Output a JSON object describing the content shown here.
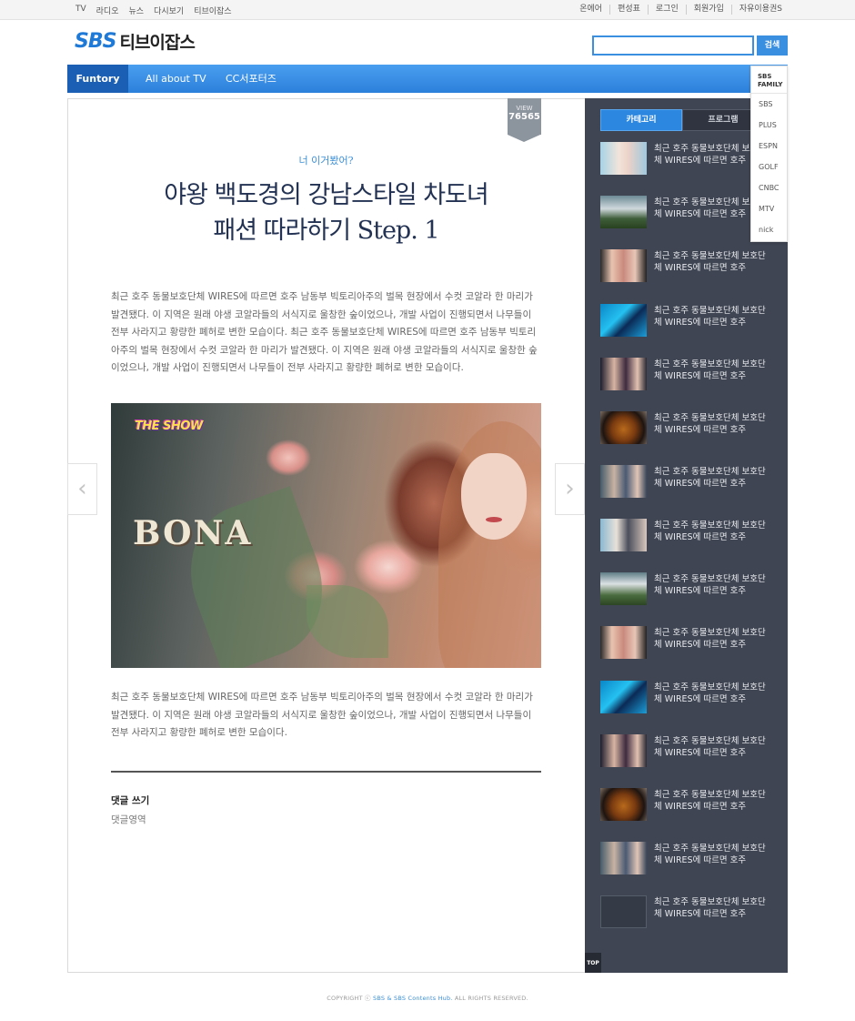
{
  "util": {
    "left_links": [
      "TV",
      "라디오",
      "뉴스",
      "다시보기",
      "티브이잡스"
    ],
    "right_links": [
      "온에어",
      "편성표",
      "로그인",
      "회원가입",
      "자유이용권S"
    ]
  },
  "header": {
    "logo_sbs": "SBS",
    "logo_name": "티브이잡스",
    "search_placeholder": "",
    "search_button": "검색"
  },
  "gnb": {
    "items": [
      "Funtory",
      "All about TV",
      "CC서포터즈"
    ],
    "active": "Funtory"
  },
  "family": {
    "title_line1": "SBS",
    "title_line2": "FAMILY",
    "items": [
      "SBS",
      "PLUS",
      "ESPN",
      "GOLF",
      "CNBC",
      "MTV",
      "nick"
    ]
  },
  "article": {
    "view_label": "VIEW",
    "view_count": "76565",
    "category": "너 이거봤어?",
    "title_line1": "야왕 백도경의 강남스타일 차도녀",
    "title_line2": "패션 따라하기 Step. 1",
    "body1": "최근 호주 동물보호단체 WIRES에 따르면 호주 남동부 빅토리아주의 벌목 현장에서 수컷 코알라 한 마리가 발견됐다. 이 지역은 원래 야생 코알라들의 서식지로 울창한 숲이었으나, 개발 사업이 진행되면서 나무들이 전부 사라지고 황량한 폐허로 변한 모습이다. 최근 호주 동물보호단체 WIRES에 따르면 호주 남동부 빅토리아주의 벌목 현장에서 수컷 코알라 한 마리가 발견됐다. 이 지역은 원래 야생 코알라들의 서식지로 울창한 숲이었으나, 개발 사업이 진행되면서 나무들이 전부 사라지고 황량한 폐허로 변한 모습이다.",
    "photo_logo": "THE SHOW",
    "photo_caption": "BONA",
    "body2": "최근 호주 동물보호단체 WIRES에 따르면 호주 남동부 빅토리아주의 벌목 현장에서 수컷 코알라 한 마리가 발견됐다. 이 지역은 원래 야생 코알라들의 서식지로 울창한 숲이었으나, 개발 사업이 진행되면서 나무들이 전부 사라지고 황량한 폐허로 변한 모습이다.",
    "prev_arrow": "‹",
    "next_arrow": "›",
    "comment_title": "댓글 쓰기",
    "comment_area": "댓글영역"
  },
  "sidebar": {
    "tab_category": "카테고리",
    "tab_program": "프로그램",
    "items": [
      "최근 호주 동물보호단체 보호단체 WIRES에 따르면 호주",
      "최근 호주 동물보호단체 보호단체 WIRES에 따르면 호주",
      "최근 호주 동물보호단체 보호단체 WIRES에 따르면 호주",
      "최근 호주 동물보호단체 보호단체 WIRES에 따르면 호주",
      "최근 호주 동물보호단체 보호단체 WIRES에 따르면 호주",
      "최근 호주 동물보호단체 보호단체 WIRES에 따르면 호주",
      "최근 호주 동물보호단체 보호단체 WIRES에 따르면 호주",
      "최근 호주 동물보호단체 보호단체 WIRES에 따르면 호주",
      "최근 호주 동물보호단체 보호단체 WIRES에 따르면 호주",
      "최근 호주 동물보호단체 보호단체 WIRES에 따르면 호주",
      "최근 호주 동물보호단체 보호단체 WIRES에 따르면 호주",
      "최근 호주 동물보호단체 보호단체 WIRES에 따르면 호주",
      "최근 호주 동물보호단체 보호단체 WIRES에 따르면 호주",
      "최근 호주 동물보호단체 보호단체 WIRES에 따르면 호주",
      "최근 호주 동물보호단체 보호단체 WIRES에 따르면 호주"
    ],
    "top_label": "TOP"
  },
  "footer": {
    "prefix": "COPYRIGHT ⓒ ",
    "highlight": "SBS & SBS Contents Hub.",
    "suffix": " ALL RIGHTS RESERVED."
  }
}
